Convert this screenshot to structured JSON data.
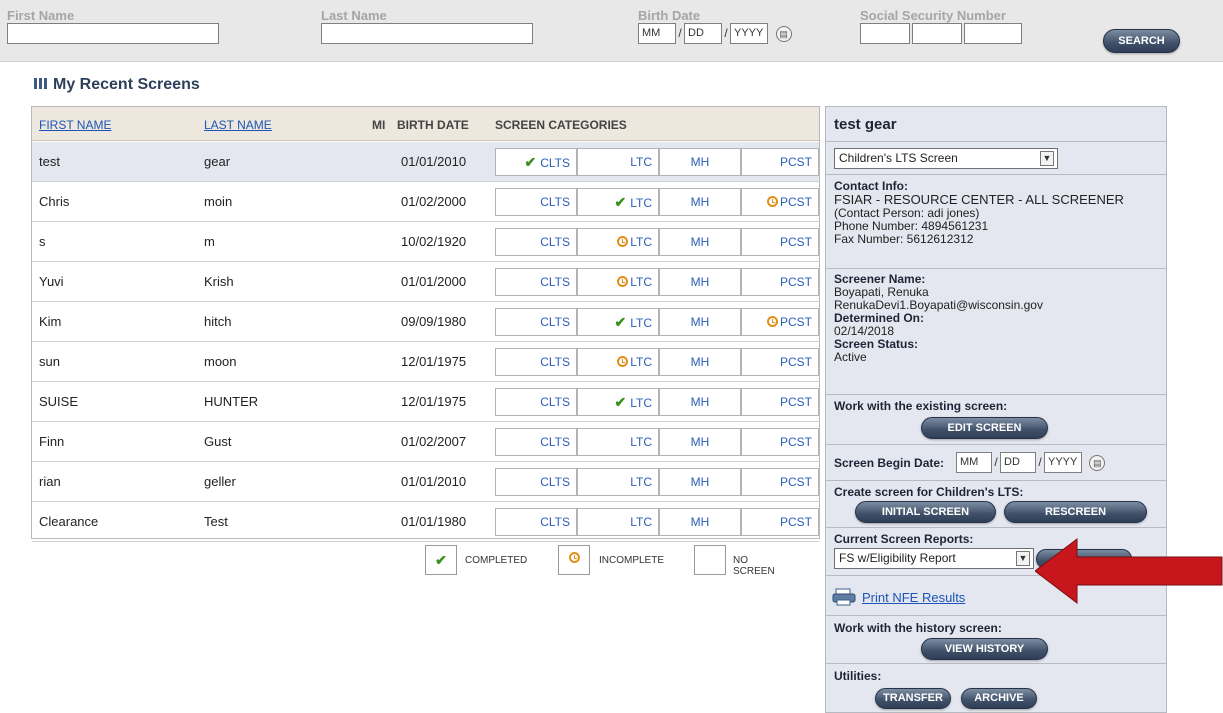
{
  "search": {
    "first_name_label": "First Name",
    "last_name_label": "Last Name",
    "birth_date_label": "Birth Date",
    "ssn_label": "Social Security Number",
    "birth_mm_placeholder": "MM",
    "birth_dd_placeholder": "DD",
    "birth_yyyy_placeholder": "YYYY",
    "search_button": "SEARCH",
    "date_separator": "/"
  },
  "recent": {
    "title": "My Recent Screens",
    "columns": {
      "first_name": "FIRST NAME",
      "last_name": "LAST NAME",
      "mi": "MI",
      "birth_date": "BIRTH DATE",
      "categories": "SCREEN CATEGORIES"
    },
    "category_labels": [
      "CLTS",
      "LTC",
      "MH",
      "PCST"
    ],
    "rows": [
      {
        "first": "test",
        "last": "gear",
        "dob": "01/01/2010",
        "status": [
          "completed",
          "none",
          "none",
          "none"
        ]
      },
      {
        "first": "Chris",
        "last": "moin",
        "dob": "01/02/2000",
        "status": [
          "none",
          "completed",
          "none",
          "incomplete"
        ]
      },
      {
        "first": "s",
        "last": "m",
        "dob": "10/02/1920",
        "status": [
          "none",
          "incomplete",
          "none",
          "none"
        ]
      },
      {
        "first": "Yuvi",
        "last": "Krish",
        "dob": "01/01/2000",
        "status": [
          "none",
          "incomplete",
          "none",
          "none"
        ]
      },
      {
        "first": "Kim",
        "last": "hitch",
        "dob": "09/09/1980",
        "status": [
          "none",
          "completed",
          "none",
          "incomplete"
        ]
      },
      {
        "first": "sun",
        "last": "moon",
        "dob": "12/01/1975",
        "status": [
          "none",
          "incomplete",
          "none",
          "none"
        ]
      },
      {
        "first": "SUISE",
        "last": "HUNTER",
        "dob": "12/01/1975",
        "status": [
          "none",
          "completed",
          "none",
          "none"
        ]
      },
      {
        "first": "Finn",
        "last": "Gust",
        "dob": "01/02/2007",
        "status": [
          "none",
          "none",
          "none",
          "none"
        ]
      },
      {
        "first": "rian",
        "last": "geller",
        "dob": "01/01/2010",
        "status": [
          "none",
          "none",
          "none",
          "none"
        ]
      },
      {
        "first": "Clearance",
        "last": "Test",
        "dob": "01/01/1980",
        "status": [
          "none",
          "none",
          "none",
          "none"
        ]
      }
    ]
  },
  "legend": {
    "completed": "COMPLETED",
    "incomplete": "INCOMPLETE",
    "no_screen": "NO SCREEN"
  },
  "detail": {
    "title": "test gear",
    "screen_type": "Children's LTS Screen",
    "contact_label": "Contact Info:",
    "contact_org": "FSIAR - RESOURCE CENTER - ALL SCREENER",
    "contact_person": "(Contact Person: adi jones)",
    "phone": "Phone Number: 4894561231",
    "fax": "Fax Number: 5612612312",
    "screener_label": "Screener Name:",
    "screener_name": "Boyapati, Renuka",
    "screener_email": "RenukaDevi1.Boyapati@wisconsin.gov",
    "determined_label": "Determined On:",
    "determined_on": "02/14/2018",
    "status_label": "Screen Status:",
    "status": "Active",
    "existing_label": "Work with the existing screen:",
    "edit_button": "EDIT SCREEN",
    "begin_date_label": "Screen Begin Date:",
    "begin_mm": "MM",
    "begin_dd": "DD",
    "begin_yyyy": "YYYY",
    "create_label": "Create screen for Children's LTS:",
    "initial_button": "INITIAL SCREEN",
    "rescreen_button": "RESCREEN",
    "reports_label": "Current Screen Reports:",
    "report_selected": "FS w/Eligibility Report",
    "print_link": "Print NFE Results",
    "history_label": "Work with the history screen:",
    "history_button": "VIEW HISTORY",
    "utilities_label": "Utilities:",
    "transfer_button": "TRANSFER",
    "archive_button": "ARCHIVE"
  },
  "colors": {
    "header_bar": "#e8e8e8",
    "table_header": "#ede7dd",
    "panel_bg": "#e4e7ef",
    "link_blue": "#1c55b8",
    "check_green": "#3b8f1c",
    "clock_orange": "#e2901a",
    "annotation_red": "#c8161d"
  }
}
